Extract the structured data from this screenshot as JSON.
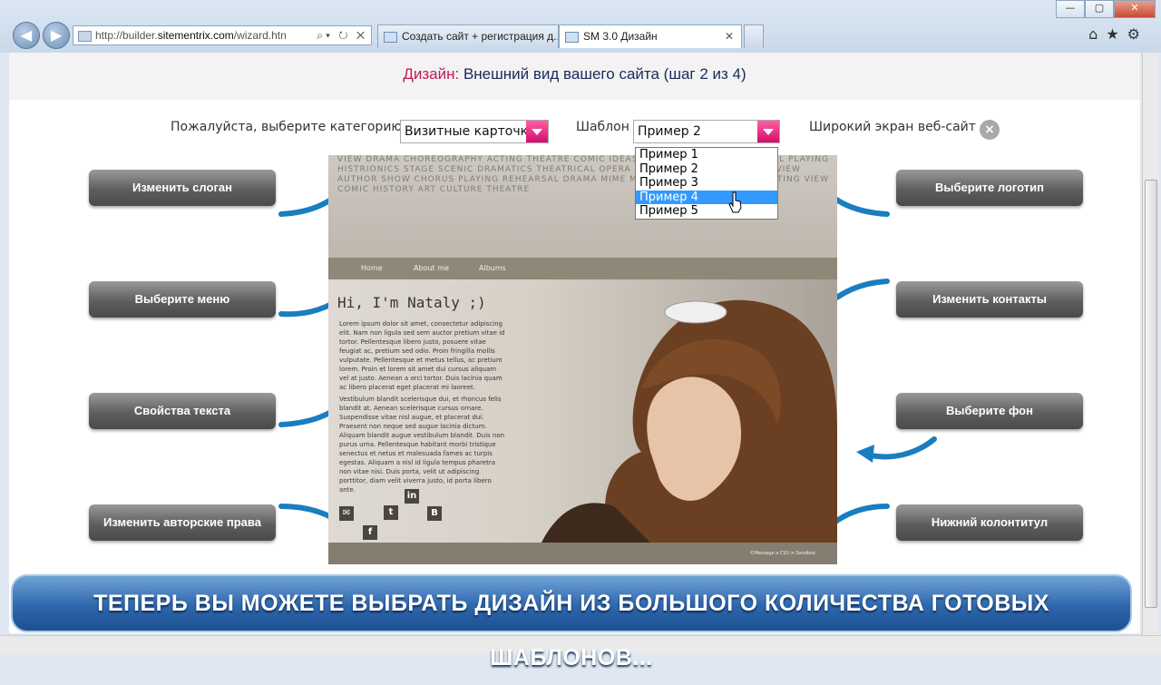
{
  "browser": {
    "back": "◀",
    "forward": "▶",
    "url_prefix": "http://builder.",
    "url_host": "sitementrix.com",
    "url_path": "/wizard.htn",
    "addr_tools": "⌕▾ ↻ ✕",
    "tabs": [
      {
        "label": "Создать сайт + регистрация д...",
        "close": ""
      },
      {
        "label": "SM 3.0 Дизайн",
        "close": "✕"
      }
    ],
    "right_tools": "⌂★⚙",
    "window_controls": {
      "minimize": "—",
      "maximize": "▢",
      "close": "✕"
    }
  },
  "header": {
    "key": "Дизайн:",
    "text": "Внешний вид вашего сайта (шаг 2 из 4)"
  },
  "selectors": {
    "category_label": "Пожалуйста, выберите категорию",
    "category_value": "Визитные карточки",
    "template_label": "Шаблон",
    "template_value": "Пример 2",
    "widescreen_label": "Широкий экран веб-сайт",
    "widescreen_close": "×"
  },
  "dropdown": {
    "options": [
      "Пример 1",
      "Пример 2",
      "Пример 3",
      "Пример 4",
      "Пример 5"
    ],
    "highlighted": "Пример 4"
  },
  "left_buttons": [
    "Изменить слоган",
    "Выберите меню",
    "Свойства текста",
    "Изменить авторские права"
  ],
  "right_buttons": [
    "Выберите логотип",
    "Изменить контакты",
    "Выберите фон",
    "Нижний колонтитул"
  ],
  "preview": {
    "nav": [
      "Home",
      "About me",
      "Albums"
    ],
    "title": "Hi, I'm Nataly ;)",
    "para1": "Lorem ipsum dolor sit amet, consectetur adipiscing elit. Nam non ligula sed sem auctor pretium vitae id tortor. Pellentesque libero justo, posuere vitae feugiat ac, pretium sed odio. Proin fringilla mollis vulputate. Pellentesque et metus tellus, ac pretium lorem. Proin et lorem sit amet dui cursus aliquam vel at justo. Aenean a orci tortor. Duis lacinia quam ac libero placerat eget placerat mi laoreet.",
    "para2": "Vestibulum blandit scelerisque dui, et rhoncus felis blandit at. Aenean scelerisque cursus ornare. Suspendisse vitae nisl augue, et placerat dui. Praesent non neque sed augue lacinia dictum. Aliquam blandit augue vestibulum blandit. Duis non purus urna. Pellentesque habitant morbi tristique senectus et netus et malesuada fames ac turpis egestas. Aliquam a nisl id ligula tempus pharetra non vitae nisi. Duis porta, velit ut adipiscing porttitor, diam velit viverra justo, id porta libero ante.",
    "words": "VIEW DRAMA CHOREOGRAPHY ACTING THEATRE COMIC IDEAS CULTURE BALLET REHEARSAL PLAYING HISTRIONICS STAGE SCENIC DRAMATICS THEATRICAL OPERA MUSIC ART ACTOR CONCERT VIEW AUTHOR SHOW CHORUS PLAYING REHEARSAL DRAMA MIME MUSICAL DIRECTOR SCENE ACTING VIEW COMIC HISTORY ART CULTURE THEATRE",
    "social": [
      "✉",
      "f",
      "t",
      "in",
      "B"
    ],
    "footer": "©Message a CSS in Sandbox"
  },
  "banner": "ТЕПЕРЬ ВЫ МОЖЕТЕ ВЫБРАТЬ ДИЗАЙН ИЗ БОЛЬШОГО КОЛИЧЕСТВА ГОТОВЫХ ШАБЛОНОВ...",
  "colors": {
    "accent": "#c2185b",
    "arrow": "#1a7dc0",
    "banner": "#2d67ad",
    "highlight": "#3399ff"
  }
}
